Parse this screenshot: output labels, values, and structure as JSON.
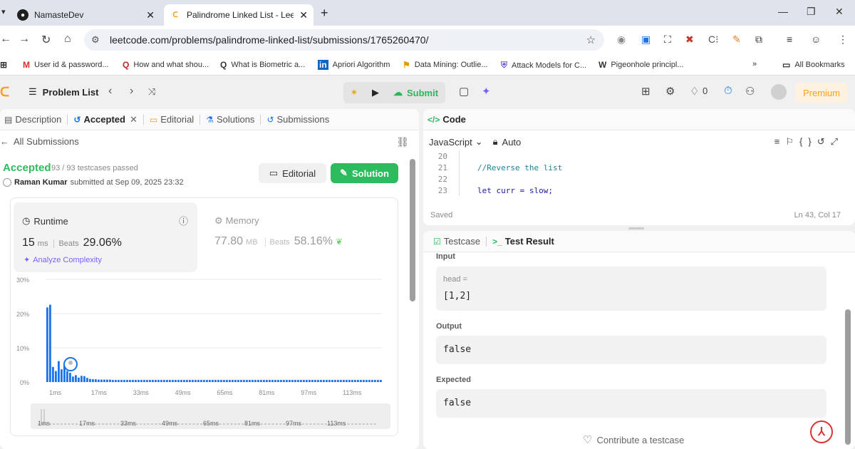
{
  "browser": {
    "tabs": [
      {
        "title": "NamasteDev"
      },
      {
        "title": "Palindrome Linked List - LeetCo"
      }
    ],
    "url": "leetcode.com/problems/palindrome-linked-list/submissions/1765260470/",
    "bookmarks": [
      "User id & password...",
      "How and what shou...",
      "What is Biometric a...",
      "Apriori Algorithm",
      "Data Mining: Outlie...",
      "Attack Models for C...",
      "Pigeonhole principl..."
    ],
    "more_bookmarks": "»",
    "all_bookmarks": "All Bookmarks"
  },
  "nav": {
    "problem_list": "Problem List",
    "submit": "Submit",
    "counter": "0",
    "premium": "Premium"
  },
  "left": {
    "tabs": [
      "Description",
      "Accepted",
      "Editorial",
      "Solutions",
      "Submissions"
    ],
    "all_submissions": "All Submissions",
    "status": "Accepted",
    "testcases": "93 / 93 testcases passed",
    "author": "Raman Kumar",
    "submitted": "submitted at Sep 09, 2025 23:32",
    "editorial_btn": "Editorial",
    "solution_btn": "Solution",
    "runtime": {
      "title": "Runtime",
      "value": "15",
      "unit": "ms",
      "beats_label": "Beats",
      "beats": "29.06%",
      "analyze": "Analyze Complexity"
    },
    "memory": {
      "title": "Memory",
      "value": "77.80",
      "unit": "MB",
      "beats_label": "Beats",
      "beats": "58.16%"
    }
  },
  "chart_data": {
    "type": "bar",
    "ylabel_ticks": [
      "0%",
      "10%",
      "20%",
      "30%"
    ],
    "ylim": [
      0,
      30
    ],
    "x_ticks": [
      "1ms",
      "17ms",
      "33ms",
      "49ms",
      "65ms",
      "81ms",
      "97ms",
      "113ms"
    ],
    "values": [
      21.8,
      22.6,
      4.4,
      3.2,
      6.1,
      3.7,
      5.3,
      3.2,
      2.7,
      1.6,
      2.0,
      1.3,
      1.8,
      1.7,
      1.2,
      0.9,
      0.8,
      0.8,
      0.7,
      0.7,
      0.7,
      0.7,
      0.7,
      0.6,
      0.6,
      0.6,
      0.6,
      0.6,
      0.6,
      0.6,
      0.6,
      0.6,
      0.6,
      0.6,
      0.6,
      0.6,
      0.6,
      0.6,
      0.6,
      0.6,
      0.6,
      0.6,
      0.6,
      0.6,
      0.6,
      0.6,
      0.6,
      0.6,
      0.6,
      0.6,
      0.6,
      0.6,
      0.6,
      0.6,
      0.6,
      0.6,
      0.6,
      0.6,
      0.6,
      0.6,
      0.6,
      0.6,
      0.6,
      0.6,
      0.6,
      0.6,
      0.6,
      0.6,
      0.6,
      0.6,
      0.6,
      0.6,
      0.6,
      0.6,
      0.6,
      0.6,
      0.6,
      0.6,
      0.6,
      0.6,
      0.6,
      0.6,
      0.6,
      0.6,
      0.6,
      0.6,
      0.6,
      0.6,
      0.6,
      0.6,
      0.6,
      0.6,
      0.6,
      0.6,
      0.6,
      0.6,
      0.6,
      0.6,
      0.6,
      0.6,
      0.6,
      0.6,
      0.6,
      0.6,
      0.6,
      0.6,
      0.6,
      0.6,
      0.6,
      0.6,
      0.6,
      0.6,
      0.6,
      0.6,
      0.6,
      0.6,
      0.6,
      0.6
    ],
    "highlight_index": 8,
    "color": "#1a73e8",
    "grid": true
  },
  "code": {
    "title": "Code",
    "language": "JavaScript",
    "mode": "Auto",
    "lines": [
      {
        "num": "20",
        "text": ""
      },
      {
        "num": "21",
        "text": "//Reverse the list"
      },
      {
        "num": "22",
        "text": ""
      },
      {
        "num": "23",
        "text": "let curr = slow;"
      }
    ],
    "saved": "Saved",
    "position": "Ln 43, Col 17"
  },
  "test": {
    "tab_testcase": "Testcase",
    "tab_result": "Test Result",
    "input_label": "Input",
    "input_var": "head =",
    "input_value": "[1,2]",
    "output_label": "Output",
    "output_value": "false",
    "expected_label": "Expected",
    "expected_value": "false",
    "contribute": "Contribute a testcase"
  }
}
